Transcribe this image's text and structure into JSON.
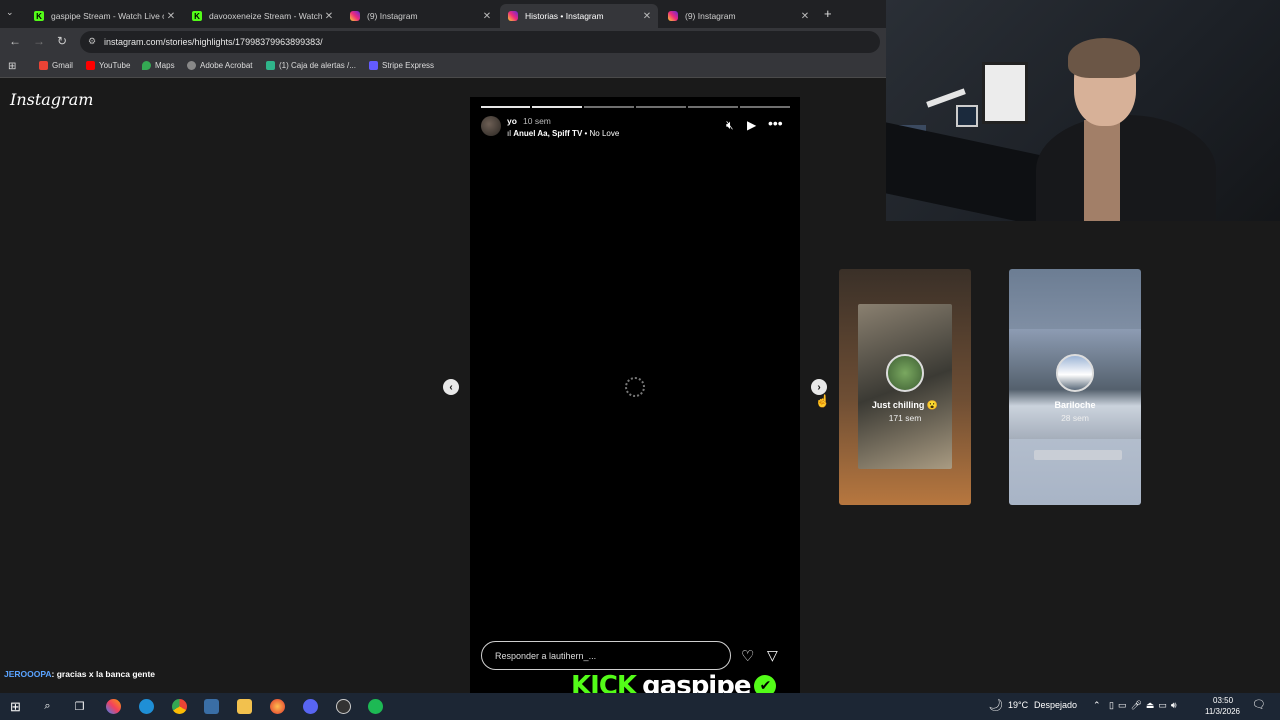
{
  "browser": {
    "tabs": [
      {
        "title": "gaspipe Stream - Watch Live o",
        "icon": "kick-icon",
        "active": false
      },
      {
        "title": "davooxeneize Stream - Watch L",
        "icon": "kick-icon",
        "active": false
      },
      {
        "title": "(9) Instagram",
        "icon": "instagram-icon",
        "active": false
      },
      {
        "title": "Historias • Instagram",
        "icon": "instagram-icon",
        "active": true
      },
      {
        "title": "(9) Instagram",
        "icon": "instagram-icon",
        "active": false
      }
    ],
    "new_tab": "+",
    "url": "instagram.com/stories/highlights/17998379963899383/",
    "bookmarks": [
      "Gmail",
      "YouTube",
      "Maps",
      "Adobe Acrobat",
      "(1) Caja de alertas /...",
      "Stripe Express"
    ]
  },
  "instagram": {
    "logo": "Instagram",
    "story": {
      "username": "yo",
      "time": "10 sem",
      "music_artist": "Anuel Aa, Spiff TV",
      "music_sep": " • ",
      "music_song": "No Love",
      "reply_placeholder": "Responder a lautihern_...",
      "segments_total": 6,
      "segment_active": 2
    },
    "next_highlights": [
      {
        "title": "Just chilling 😮",
        "time": "171 sem"
      },
      {
        "title": "Bariloche",
        "time": "28 sem"
      }
    ]
  },
  "stream": {
    "chat_user": "JEROOOPA",
    "chat_message": ": gracias x la banca gente",
    "kick_brand": "KICK",
    "channel": "gaspipe"
  },
  "taskbar": {
    "weather_temp": "19°C",
    "weather_desc": "Despejado",
    "time": "03:50",
    "date": "11/3/2026"
  },
  "colors": {
    "kick_green": "#53fc18",
    "taskbar": "#1c2634"
  }
}
